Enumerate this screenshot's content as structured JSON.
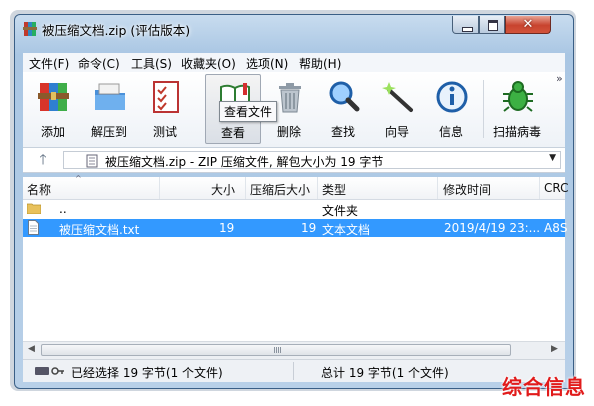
{
  "window": {
    "title": "被压缩文档.zip (评估版本)"
  },
  "menu": [
    "文件(F)",
    "命令(C)",
    "工具(S)",
    "收藏夹(O)",
    "选项(N)",
    "帮助(H)"
  ],
  "toolbar": {
    "buttons": [
      {
        "label": "添加",
        "icon": "books-add-icon"
      },
      {
        "label": "解压到",
        "icon": "folder-extract-icon"
      },
      {
        "label": "测试",
        "icon": "checklist-test-icon"
      },
      {
        "label": "查看",
        "icon": "book-view-icon"
      },
      {
        "label": "删除",
        "icon": "trash-delete-icon"
      },
      {
        "label": "查找",
        "icon": "magnifier-find-icon"
      },
      {
        "label": "向导",
        "icon": "wand-wizard-icon"
      },
      {
        "label": "信息",
        "icon": "info-icon"
      },
      {
        "label": "扫描病毒",
        "icon": "bug-scan-icon"
      }
    ],
    "overflow": "»",
    "tooltip": "查看文件"
  },
  "address": {
    "text": "被压缩文档.zip - ZIP 压缩文件, 解包大小为 19 字节"
  },
  "columns": [
    "名称",
    "大小",
    "压缩后大小",
    "类型",
    "修改时间",
    "CRC"
  ],
  "rows": [
    {
      "name": "..",
      "size": "",
      "packed": "",
      "type": "文件夹",
      "modified": "",
      "crc": ""
    },
    {
      "name": "被压缩文档.txt",
      "size": "19",
      "packed": "19",
      "type": "文本文档",
      "modified": "2019/4/19 23:...",
      "crc": "A8S"
    }
  ],
  "status": {
    "left": "已经选择 19 字节(1 个文件)",
    "right": "总计 19 字节(1 个文件)"
  },
  "watermark": "综合信息",
  "colors": {
    "selection": "#3399ff",
    "close_button": "#c8432e",
    "watermark": "#e11b1b"
  }
}
